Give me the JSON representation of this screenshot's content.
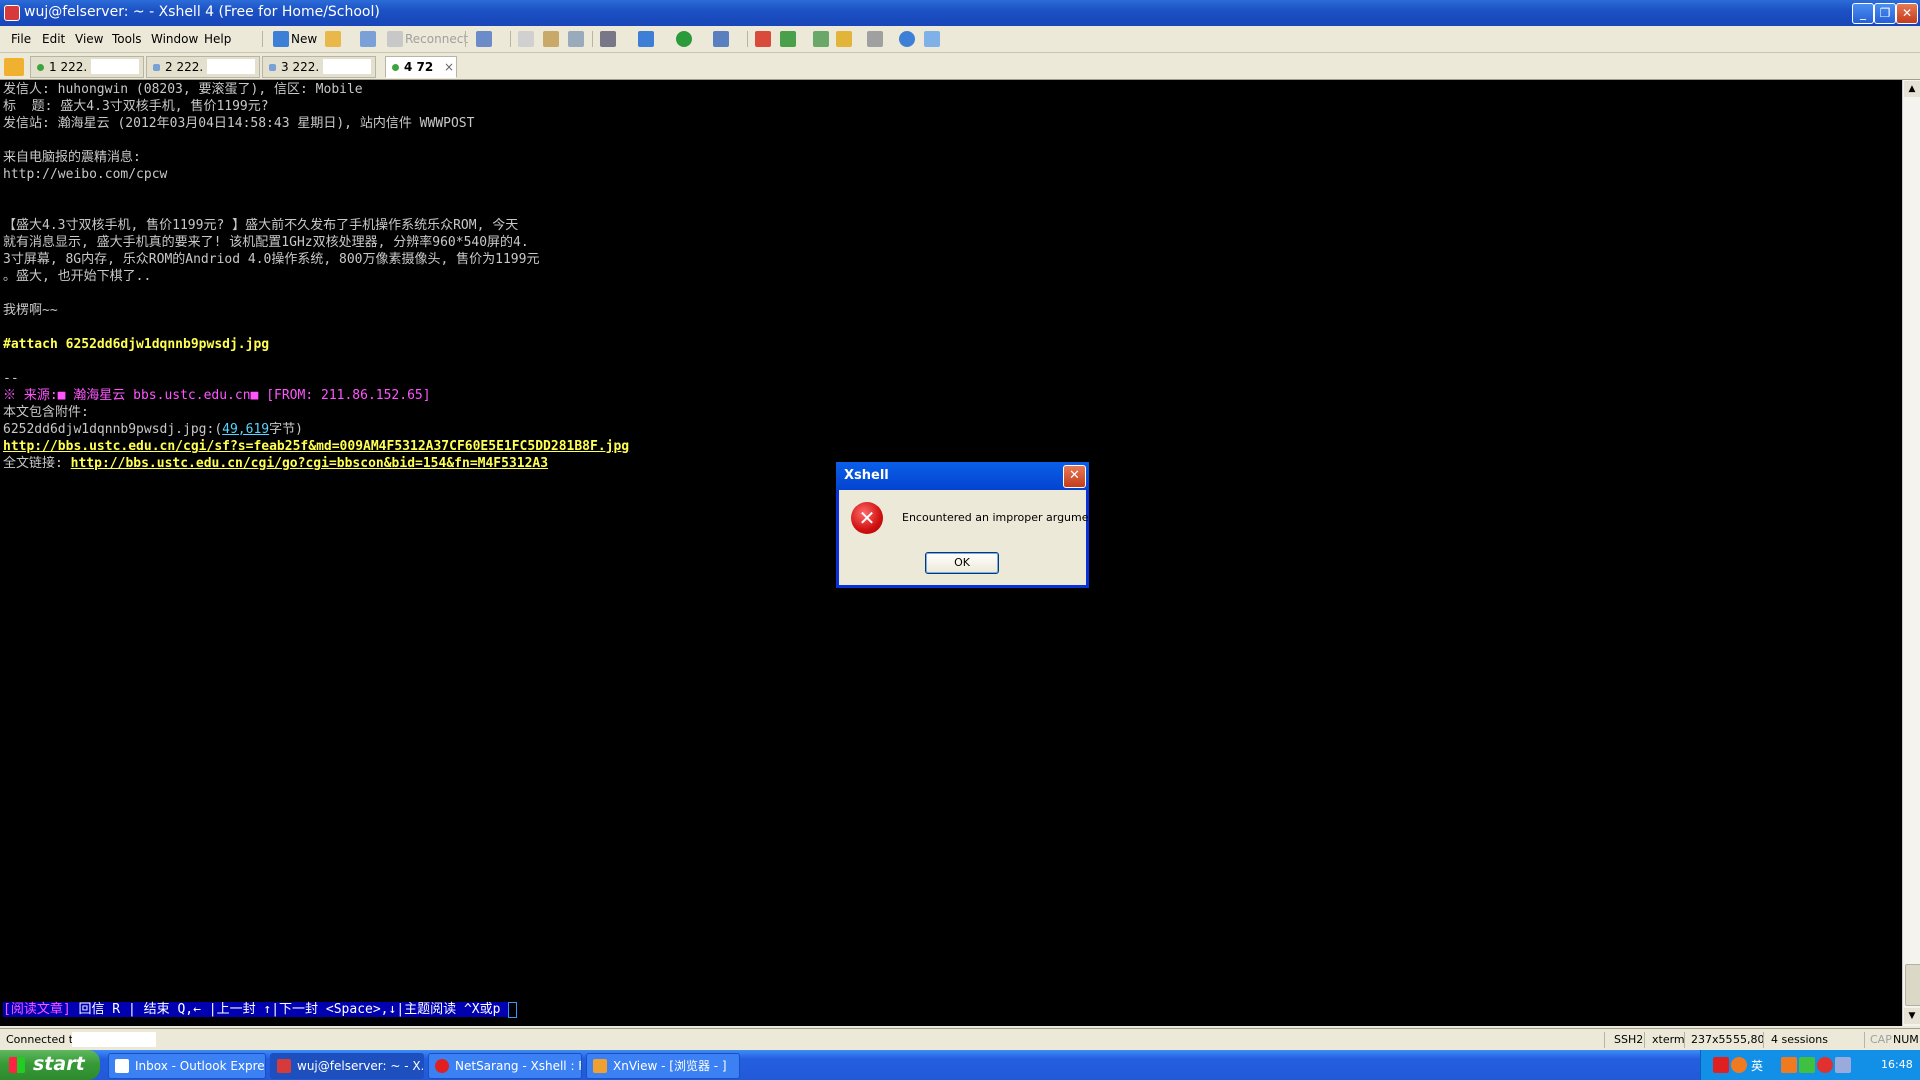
{
  "window": {
    "title": "wuj@felserver: ~ - Xshell 4 (Free for Home/School)",
    "min": "_",
    "max": "❐",
    "close": "✕"
  },
  "menu": [
    "File",
    "Edit",
    "View",
    "Tools",
    "Window",
    "Help"
  ],
  "toolbar": {
    "new_label": "New",
    "reconnect_label": "Reconnect"
  },
  "tabs": [
    {
      "label": "1 222.",
      "active": false
    },
    {
      "label": "2 222.",
      "active": false
    },
    {
      "label": "3 222.",
      "active": false
    },
    {
      "label": "4 72",
      "active": true
    }
  ],
  "terminal": {
    "lines": [
      "发信人: huhongwin (08203, 要滚蛋了), 信区: Mobile",
      "标  题: 盛大4.3寸双核手机, 售价1199元?",
      "发信站: 瀚海星云 (2012年03月04日14:58:43 星期日), 站内信件 WWWPOST",
      "",
      "来自电脑报的震精消息:",
      "http://weibo.com/cpcw",
      "",
      "",
      "【盛大4.3寸双核手机, 售价1199元? 】盛大前不久发布了手机操作系统乐众ROM, 今天",
      "就有消息显示, 盛大手机真的要来了! 该机配置1GHz双核处理器, 分辨率960*540屏的4.",
      "3寸屏幕, 8G内存, 乐众ROM的Andriod 4.0操作系统, 800万像素摄像头, 售价为1199元",
      "。盛大, 也开始下棋了..",
      "",
      "我楞啊~~",
      ""
    ],
    "attach_line": "#attach 6252dd6djw1dqnnb9pwsdj.jpg",
    "sig_dash": "--",
    "source_prefix": "※ 来源:■ 瀚海星云 ",
    "source_host": "bbs.ustc.edu.cn",
    "source_from": "■ [FROM: 211.86.152.65]",
    "attach_header": "本文包含附件:",
    "attach_file_prefix": "6252dd6djw1dqnnb9pwsdj.jpg:(",
    "attach_file_size": "49,619",
    "attach_file_suffix": "字节)",
    "attach_url": "http://bbs.ustc.edu.cn/cgi/sf?s=feab25f&md=009AM4F5312A37CF60E5E1FC5DD281B8F.jpg",
    "fulltext_prefix": "全文链接: ",
    "fulltext_url": "http://bbs.ustc.edu.cn/cgi/go?cgi=bbscon&bid=154&fn=M4F5312A3",
    "status_line": {
      "mode": "[阅读文章]",
      "rest": " 回信 R | 结束 Q,← |上一封 ↑|下一封 <Space>,↓|主题阅读 ^X或p "
    }
  },
  "statusbar": {
    "connected": "Connected to",
    "protocol": "SSH2",
    "term": "xterm",
    "size": "237x55",
    "cursor": "55,80",
    "sessions": "4 sessions",
    "cap": "CAP",
    "num": "NUM"
  },
  "taskbar": {
    "start": "start",
    "items": [
      {
        "label": "Inbox - Outlook Express",
        "active": false
      },
      {
        "label": "wuj@felserver: ~ - X...",
        "active": true
      },
      {
        "label": "NetSarang - Xshell : F...",
        "active": false
      },
      {
        "label": "XnView - [浏览器 - ]",
        "active": false
      }
    ],
    "ime": "英",
    "clock": "16:48"
  },
  "dialog": {
    "title": "Xshell",
    "message": "Encountered an improper argument.",
    "ok": "OK"
  }
}
